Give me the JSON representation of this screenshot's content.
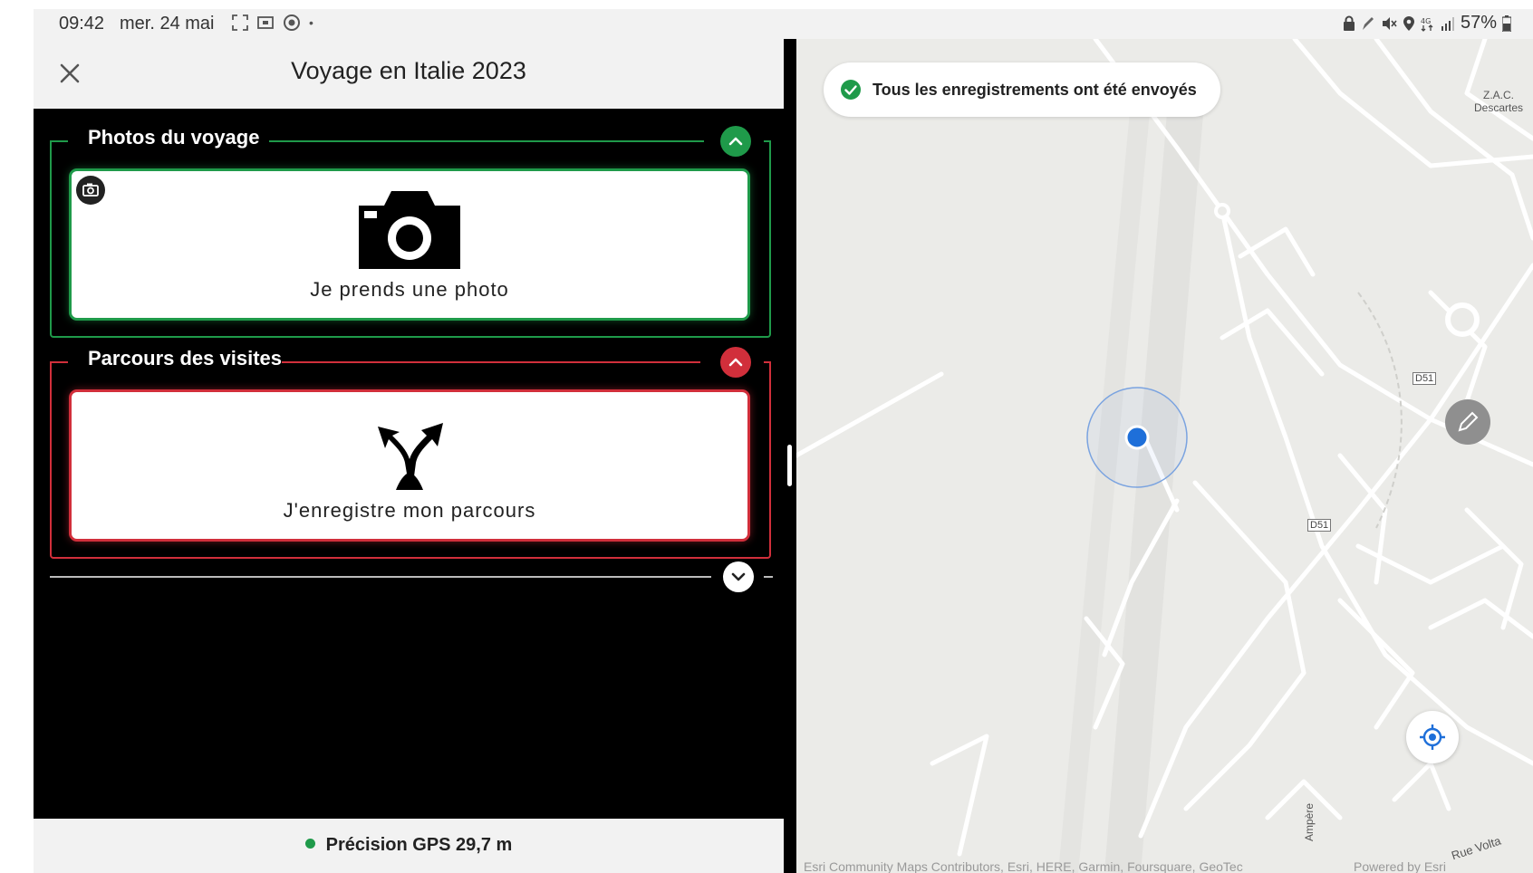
{
  "status_bar": {
    "time": "09:42",
    "date": "mer. 24 mai",
    "battery": "57%"
  },
  "header": {
    "title": "Voyage en Italie 2023"
  },
  "groups": [
    {
      "title": "Photos du voyage",
      "color": "#1f9a4a",
      "card_label": "Je prends une photo"
    },
    {
      "title": "Parcours des visites",
      "color": "#d12f3b",
      "card_label": "J'enregistre mon parcours"
    }
  ],
  "footer": {
    "gps_text": "Précision GPS 29,7 m",
    "gps_status_color": "#1f9a4a"
  },
  "map": {
    "toast": "Tous les enregistrements ont été envoyés",
    "place_label_1": "Z.A.C.",
    "place_label_2": "Descartes",
    "road_sign_1": "D51",
    "road_sign_2": "D51",
    "street_1": "Rue Volta",
    "street_2": "Ampère",
    "attribution": "Esri Community Maps Contributors, Esri, HERE, Garmin, Foursquare, GeoTec",
    "powered_by": "Powered by Esri"
  }
}
